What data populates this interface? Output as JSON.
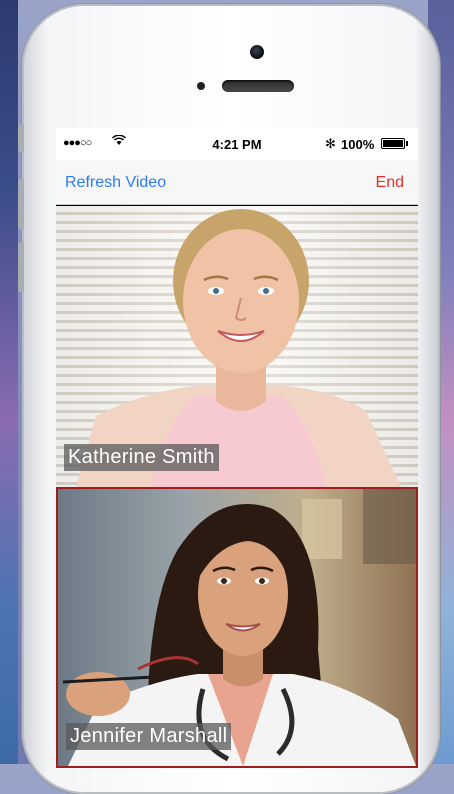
{
  "status": {
    "signal": "●●●○○",
    "wifi": "wifi-icon",
    "time": "4:21 PM",
    "bluetooth": "✻",
    "battery_pct": "100%"
  },
  "nav": {
    "left_label": "Refresh Video",
    "right_label": "End"
  },
  "videos": [
    {
      "name": "Katherine Smith"
    },
    {
      "name": "Jennifer Marshall"
    }
  ],
  "colors": {
    "accent": "#2a7df3",
    "end": "#e6312b",
    "active_frame": "#9c1e1e"
  }
}
